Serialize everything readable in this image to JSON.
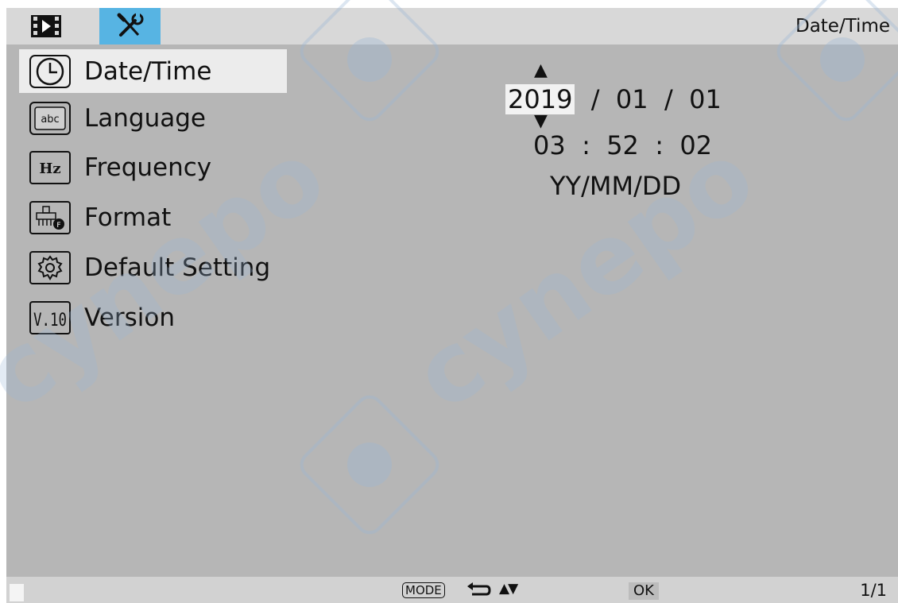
{
  "top_bar": {
    "tabs": [
      {
        "icon": "film-playback-icon"
      },
      {
        "icon": "wrench-screwdriver-icon",
        "selected": true
      }
    ],
    "title": "Date/Time"
  },
  "menu": {
    "items": [
      {
        "label": "Date/Time",
        "icon": "clock-icon",
        "selected": true
      },
      {
        "label": "Language",
        "icon": "abc-language-icon",
        "icon_text": "abc"
      },
      {
        "label": "Frequency",
        "icon": "hz-icon",
        "icon_text": "Hz"
      },
      {
        "label": "Format",
        "icon": "format-brush-icon"
      },
      {
        "label": "Default Setting",
        "icon": "gear-icon"
      },
      {
        "label": "Version",
        "icon": "version-icon",
        "icon_text": "V.10"
      }
    ]
  },
  "datetime": {
    "year": "2019",
    "month": "01",
    "day": "01",
    "hour": "03",
    "minute": "52",
    "second": "02",
    "date_separator": "/",
    "time_separator": ":",
    "format": "YY/MM/DD",
    "up_arrow": "▲",
    "down_arrow": "▼"
  },
  "bottom_bar": {
    "mode_key": "MODE",
    "nav_arrows": "▲▼",
    "ok_key": "OK",
    "page": "1/1"
  },
  "watermark": {
    "text": "cynepo",
    "color": "#9ab8d6"
  },
  "colors": {
    "accent": "#57b4e3",
    "background": "#b6b6b6",
    "selected_row": "#ececec"
  }
}
